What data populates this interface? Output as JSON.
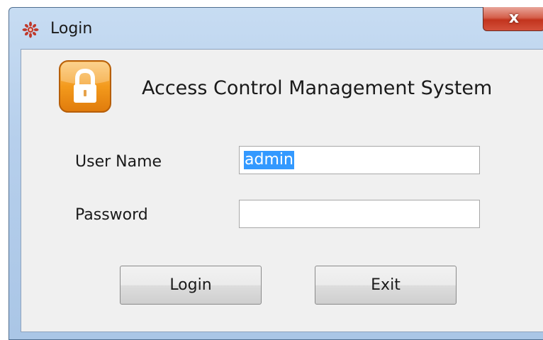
{
  "window": {
    "title": "Login",
    "close_label": "x"
  },
  "header": {
    "system_title": "Access Control Management System"
  },
  "form": {
    "username_label": "User Name",
    "username_value": "admin",
    "password_label": "Password",
    "password_value": ""
  },
  "buttons": {
    "login_label": "Login",
    "exit_label": "Exit"
  },
  "icons": {
    "app": "app-logo-icon",
    "lock": "lock-icon",
    "close": "close-icon"
  },
  "colors": {
    "selection": "#3399ff",
    "close_button": "#d3503b",
    "lock_orange": "#f39a1c"
  }
}
